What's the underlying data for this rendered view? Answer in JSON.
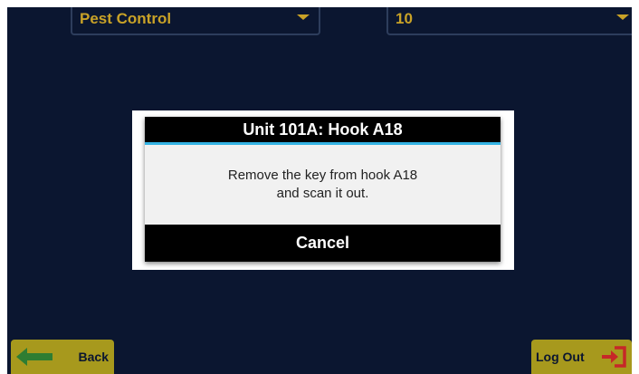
{
  "filters": {
    "category_value": "Pest Control",
    "quantity_value": "10"
  },
  "dialog": {
    "title": "Unit 101A: Hook A18",
    "message_line1": "Remove the key from hook A18",
    "message_line2": "and scan it out.",
    "cancel_label": "Cancel"
  },
  "footer": {
    "back_label": "Back",
    "logout_label": "Log Out"
  },
  "colors": {
    "background": "#0b1630",
    "accent": "#c9a227",
    "button": "#a7991d",
    "dialog_header_rule": "#34b3e4",
    "back_arrow": "#2e7d32",
    "logout_icon": "#c62828"
  },
  "icons": {
    "back": "arrow-left-icon",
    "logout": "logout-door-icon"
  }
}
